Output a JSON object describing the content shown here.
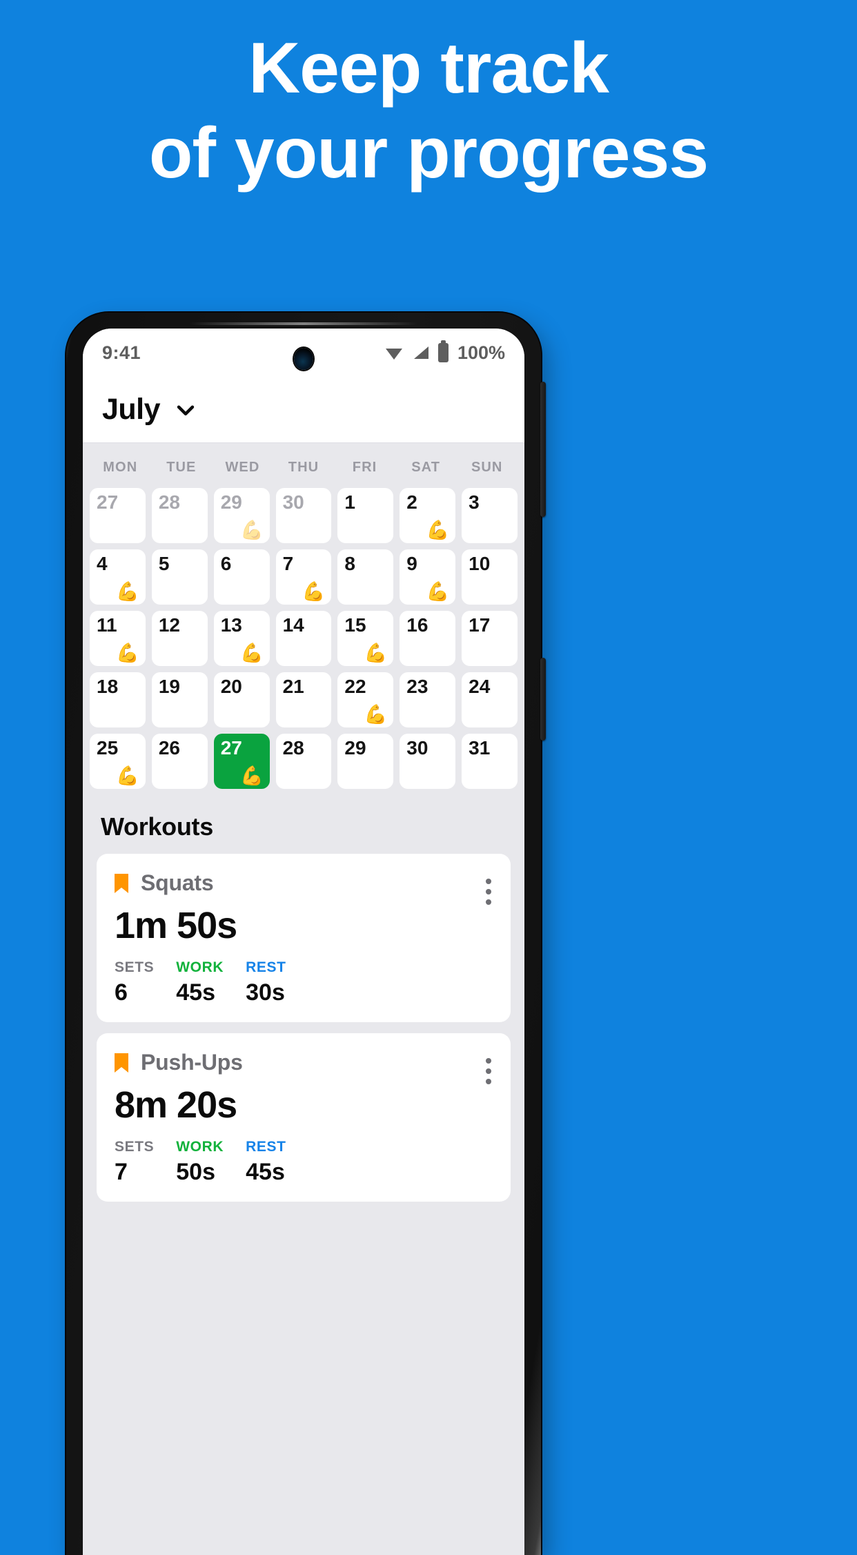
{
  "headline": {
    "line1": "Keep track",
    "line2": "of your progress"
  },
  "colors": {
    "background_blue": "#0F82DE",
    "today_green": "#0AA33F",
    "work_green": "#12B23C",
    "rest_blue": "#1683E8",
    "bookmark_orange": "#FF9500"
  },
  "status_bar": {
    "time": "9:41",
    "battery_text": "100%",
    "icons": [
      "wifi-icon",
      "cellular-signal-icon",
      "battery-icon"
    ]
  },
  "month_header": {
    "month": "July",
    "chevron": "chevron-down-icon"
  },
  "calendar": {
    "weekday_labels": [
      "MON",
      "TUE",
      "WED",
      "THU",
      "FRI",
      "SAT",
      "SUN"
    ],
    "weeks": [
      [
        {
          "num": "27",
          "muted": true,
          "emoji": ""
        },
        {
          "num": "28",
          "muted": true,
          "emoji": ""
        },
        {
          "num": "29",
          "muted": true,
          "emoji": "💪"
        },
        {
          "num": "30",
          "muted": true,
          "emoji": ""
        },
        {
          "num": "1",
          "muted": false,
          "emoji": ""
        },
        {
          "num": "2",
          "muted": false,
          "emoji": "💪"
        },
        {
          "num": "3",
          "muted": false,
          "emoji": ""
        }
      ],
      [
        {
          "num": "4",
          "muted": false,
          "emoji": "💪"
        },
        {
          "num": "5",
          "muted": false,
          "emoji": ""
        },
        {
          "num": "6",
          "muted": false,
          "emoji": ""
        },
        {
          "num": "7",
          "muted": false,
          "emoji": "💪"
        },
        {
          "num": "8",
          "muted": false,
          "emoji": ""
        },
        {
          "num": "9",
          "muted": false,
          "emoji": "💪"
        },
        {
          "num": "10",
          "muted": false,
          "emoji": ""
        }
      ],
      [
        {
          "num": "11",
          "muted": false,
          "emoji": "💪"
        },
        {
          "num": "12",
          "muted": false,
          "emoji": ""
        },
        {
          "num": "13",
          "muted": false,
          "emoji": "💪"
        },
        {
          "num": "14",
          "muted": false,
          "emoji": ""
        },
        {
          "num": "15",
          "muted": false,
          "emoji": "💪"
        },
        {
          "num": "16",
          "muted": false,
          "emoji": ""
        },
        {
          "num": "17",
          "muted": false,
          "emoji": ""
        }
      ],
      [
        {
          "num": "18",
          "muted": false,
          "emoji": ""
        },
        {
          "num": "19",
          "muted": false,
          "emoji": ""
        },
        {
          "num": "20",
          "muted": false,
          "emoji": ""
        },
        {
          "num": "21",
          "muted": false,
          "emoji": ""
        },
        {
          "num": "22",
          "muted": false,
          "emoji": "💪"
        },
        {
          "num": "23",
          "muted": false,
          "emoji": ""
        },
        {
          "num": "24",
          "muted": false,
          "emoji": ""
        }
      ],
      [
        {
          "num": "25",
          "muted": false,
          "emoji": "💪"
        },
        {
          "num": "26",
          "muted": false,
          "emoji": ""
        },
        {
          "num": "27",
          "muted": false,
          "emoji": "💪",
          "selected": true
        },
        {
          "num": "28",
          "muted": false,
          "emoji": ""
        },
        {
          "num": "29",
          "muted": false,
          "emoji": ""
        },
        {
          "num": "30",
          "muted": false,
          "emoji": ""
        },
        {
          "num": "31",
          "muted": false,
          "emoji": ""
        }
      ]
    ]
  },
  "workouts": {
    "section_title": "Workouts",
    "stat_labels": {
      "sets": "SETS",
      "work": "WORK",
      "rest": "REST"
    },
    "items": [
      {
        "name": "Squats",
        "duration": "1m 50s",
        "sets": "6",
        "work": "45s",
        "rest": "30s",
        "bookmark": "bookmark-icon",
        "menu": "overflow-menu-icon"
      },
      {
        "name": "Push-Ups",
        "duration": "8m 20s",
        "sets": "7",
        "work": "50s",
        "rest": "45s",
        "bookmark": "bookmark-icon",
        "menu": "overflow-menu-icon"
      }
    ]
  }
}
